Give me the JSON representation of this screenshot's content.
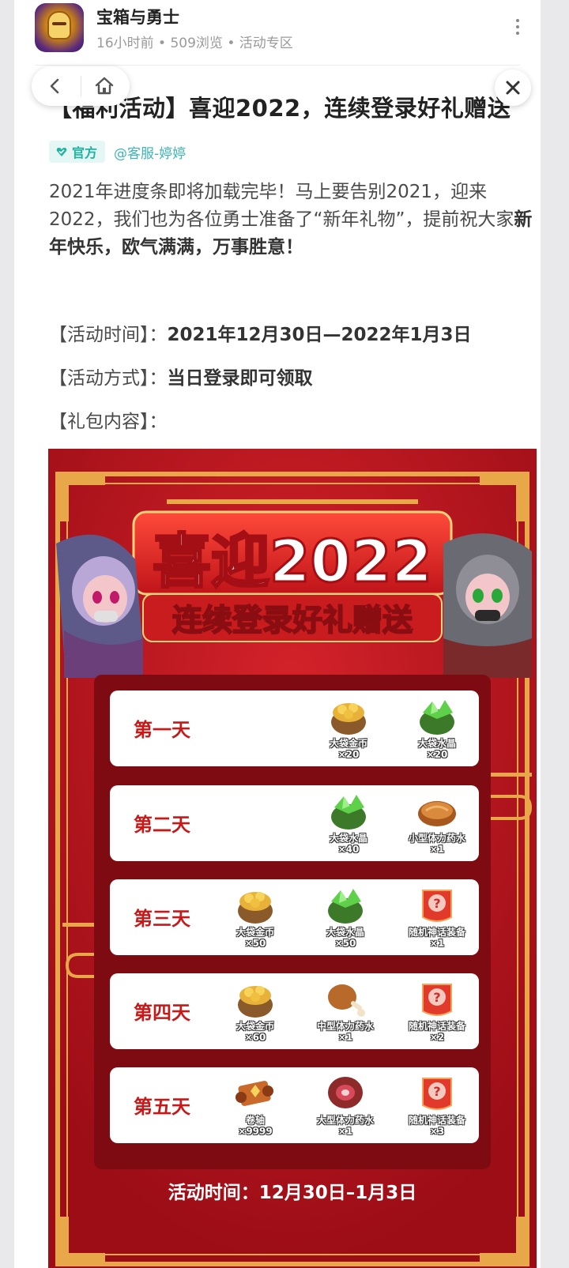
{
  "header": {
    "app_name": "宝箱与勇士",
    "meta": "16小时前 • 509浏览 • 活动专区"
  },
  "post": {
    "title": "【福利活动】喜迎2022，连续登录好礼赠送",
    "tag_label": "官方",
    "author": "@客服-婷婷",
    "intro_plain": "2021年进度条即将加载完毕！马上要告别2021，迎来2022，我们也为各位勇士准备了“新年礼物”，提前祝大家",
    "intro_bold": "新年快乐，欧气满满，万事胜意！",
    "time_label": "【活动时间】：",
    "time_value": "2021年12月30日—2022年1月3日",
    "method_label": "【活动方式】：",
    "method_value": "当日登录即可领取",
    "content_label": "【礼包内容】："
  },
  "banner": {
    "headline": "喜迎2022",
    "subheadline": "连续登录好礼赠送",
    "days": [
      {
        "label": "第一天",
        "items": [
          {
            "name": "大袋金币",
            "qty": "×20",
            "icon": "gold-bag"
          },
          {
            "name": "大袋水晶",
            "qty": "×20",
            "icon": "crystal-bag"
          }
        ]
      },
      {
        "label": "第二天",
        "items": [
          {
            "name": "大袋水晶",
            "qty": "×40",
            "icon": "crystal-bag"
          },
          {
            "name": "小型体力药水",
            "qty": "×1",
            "icon": "small-stamina"
          }
        ]
      },
      {
        "label": "第三天",
        "items": [
          {
            "name": "大袋金币",
            "qty": "×50",
            "icon": "gold-bag"
          },
          {
            "name": "大袋水晶",
            "qty": "×50",
            "icon": "crystal-bag"
          },
          {
            "name": "随机神话装备",
            "qty": "×1",
            "icon": "mystery-gear"
          }
        ]
      },
      {
        "label": "第四天",
        "items": [
          {
            "name": "大袋金币",
            "qty": "×60",
            "icon": "gold-bag"
          },
          {
            "name": "中型体力药水",
            "qty": "×1",
            "icon": "medium-stamina"
          },
          {
            "name": "随机神话装备",
            "qty": "×2",
            "icon": "mystery-gear"
          }
        ]
      },
      {
        "label": "第五天",
        "items": [
          {
            "name": "卷轴",
            "qty": "×9999",
            "icon": "scroll"
          },
          {
            "name": "大型体力药水",
            "qty": "×1",
            "icon": "large-stamina"
          },
          {
            "name": "随机神话装备",
            "qty": "×3",
            "icon": "mystery-gear"
          }
        ]
      }
    ],
    "footer": "活动时间：12月30日–1月3日"
  },
  "colors": {
    "banner_red": "#b5121b",
    "gold": "#f0b44a",
    "day_label": "#c41a1a",
    "tag_green": "#1fb3a2",
    "author_link": "#3fb4b6"
  }
}
